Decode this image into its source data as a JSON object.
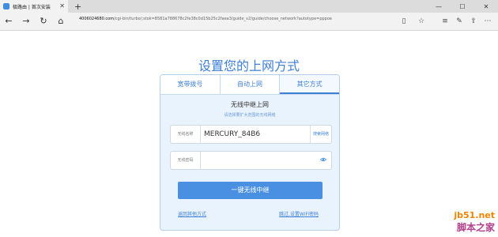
{
  "browser": {
    "tab_title": "极路由 | 首次安装",
    "new_tab": "+",
    "url_domain": "4006024680.com",
    "url_path": "/cgi-bin/turbo/;stok=8581a788678c2fe38c0d15b25c2faea3/guide_v2/guide/choose_network?autotype=pppoe"
  },
  "page": {
    "title": "设置您的上网方式"
  },
  "tabs": [
    "宽带拨号",
    "自动上网",
    "其它方式"
  ],
  "relay": {
    "heading": "无线中继上网",
    "subheading": "请选择要扩大范围的无线网络",
    "ssid_label": "无线名称",
    "ssid_value": "MERCURY_84B6",
    "search_button": "搜索网络",
    "password_label": "无线密码",
    "password_value": "",
    "submit_button": "一键无线中继",
    "back_link": "返回其他方式",
    "skip_link": "跳过,设置WiFi密码"
  },
  "watermark": {
    "line1": "jb51.net",
    "line2": "脚本之家"
  },
  "colors": {
    "accent": "#3d7fd6",
    "button": "#4a90e2",
    "panel_bg": "#e9f3fd"
  }
}
